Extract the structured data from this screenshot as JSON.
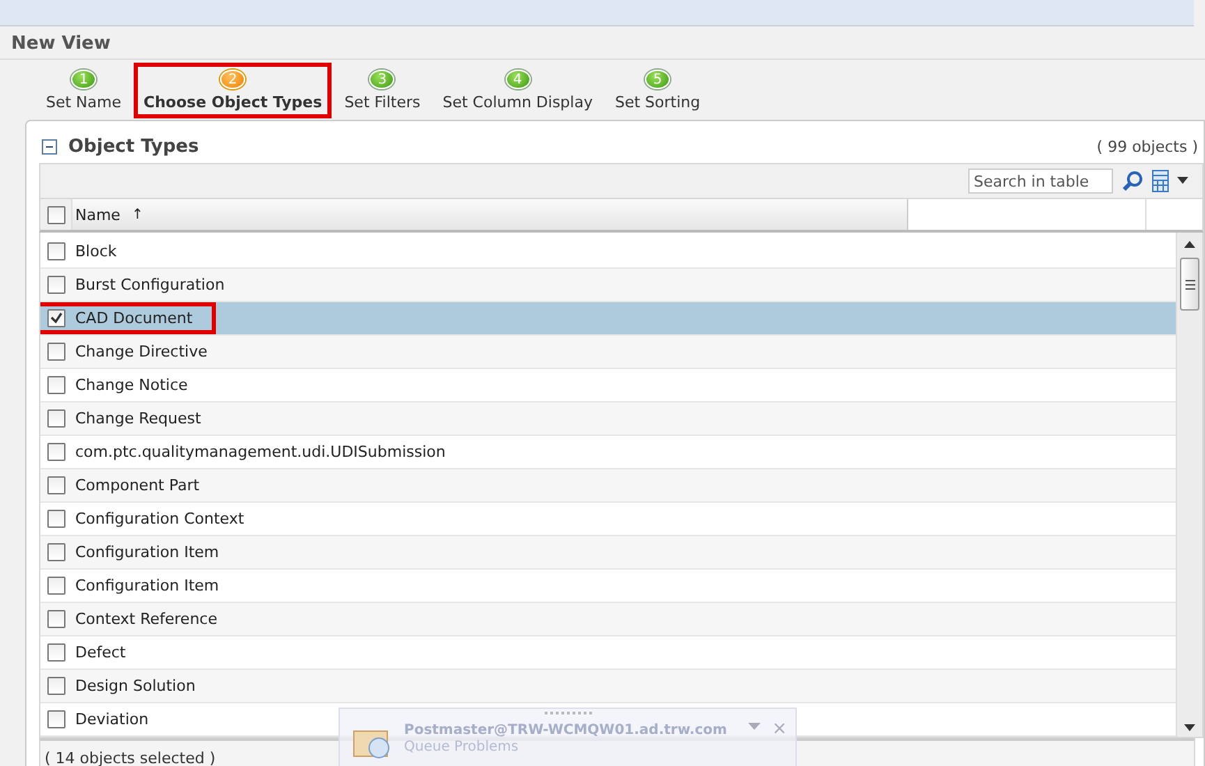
{
  "title": "New View",
  "steps": [
    {
      "number": "1",
      "label": "Set Name",
      "selected": false,
      "highlighted": false
    },
    {
      "number": "2",
      "label": "Choose Object Types",
      "selected": true,
      "highlighted": true
    },
    {
      "number": "3",
      "label": "Set Filters",
      "selected": false,
      "highlighted": false
    },
    {
      "number": "4",
      "label": "Set Column Display",
      "selected": false,
      "highlighted": false
    },
    {
      "number": "5",
      "label": "Set Sorting",
      "selected": false,
      "highlighted": false
    }
  ],
  "panel": {
    "title": "Object Types",
    "expanded": true,
    "count": "( 99 objects )"
  },
  "search": {
    "placeholder": "Search in table"
  },
  "table": {
    "columns": [
      "Name"
    ],
    "sort_mark": "↑",
    "all_checked": false,
    "rows": [
      {
        "name": "Block",
        "checked": false,
        "selected": false,
        "highlighted": false
      },
      {
        "name": "Burst Configuration",
        "checked": false,
        "selected": false,
        "highlighted": false
      },
      {
        "name": "CAD Document",
        "checked": true,
        "selected": true,
        "highlighted": true
      },
      {
        "name": "Change Directive",
        "checked": false,
        "selected": false,
        "highlighted": false
      },
      {
        "name": "Change Notice",
        "checked": false,
        "selected": false,
        "highlighted": false
      },
      {
        "name": "Change Request",
        "checked": false,
        "selected": false,
        "highlighted": false
      },
      {
        "name": "com.ptc.qualitymanagement.udi.UDISubmission",
        "checked": false,
        "selected": false,
        "highlighted": false
      },
      {
        "name": "Component Part",
        "checked": false,
        "selected": false,
        "highlighted": false
      },
      {
        "name": "Configuration Context",
        "checked": false,
        "selected": false,
        "highlighted": false
      },
      {
        "name": "Configuration Item",
        "checked": false,
        "selected": false,
        "highlighted": false
      },
      {
        "name": "Configuration Item",
        "checked": false,
        "selected": false,
        "highlighted": false
      },
      {
        "name": "Context Reference",
        "checked": false,
        "selected": false,
        "highlighted": false
      },
      {
        "name": "Defect",
        "checked": false,
        "selected": false,
        "highlighted": false
      },
      {
        "name": "Design Solution",
        "checked": false,
        "selected": false,
        "highlighted": false
      },
      {
        "name": "Deviation",
        "checked": false,
        "selected": false,
        "highlighted": false
      }
    ]
  },
  "status": "( 14 objects selected )",
  "notification": {
    "title": "Postmaster@TRW-WCMQW01.ad.trw.com",
    "message": "Queue Problems",
    "close": "×"
  }
}
